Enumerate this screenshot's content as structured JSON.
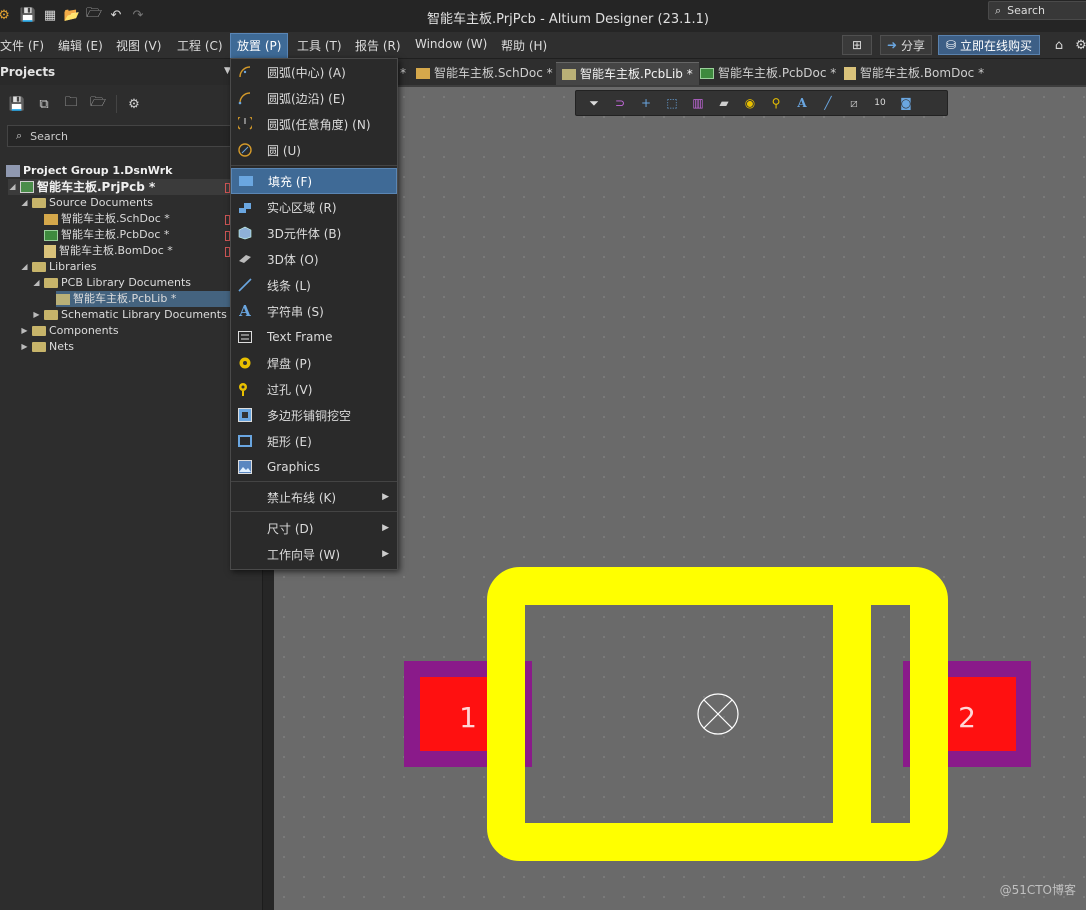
{
  "window": {
    "title": "智能车主板.PrjPcb - Altium Designer (23.1.1)",
    "search_label": "Search"
  },
  "menubar": {
    "items": [
      {
        "label": "文件 (F)"
      },
      {
        "label": "编辑 (E)"
      },
      {
        "label": "视图 (V)"
      },
      {
        "label": "工程 (C)"
      },
      {
        "label": "放置 (P)"
      },
      {
        "label": "工具 (T)"
      },
      {
        "label": "报告 (R)"
      },
      {
        "label": "Window (W)"
      },
      {
        "label": "帮助 (H)"
      }
    ],
    "share_label": "分享",
    "buy_label": "立即在线购买"
  },
  "panel": {
    "title": "Projects",
    "search_placeholder": "Search",
    "tree": [
      {
        "label": "Project Group 1.DsnWrk"
      },
      {
        "label": "智能车主板.PrjPcb *"
      },
      {
        "label": "Source Documents"
      },
      {
        "label": "智能车主板.SchDoc *"
      },
      {
        "label": "智能车主板.PcbDoc *"
      },
      {
        "label": "智能车主板.BomDoc *"
      },
      {
        "label": "Libraries"
      },
      {
        "label": "PCB Library Documents"
      },
      {
        "label": "智能车主板.PcbLib *"
      },
      {
        "label": "Schematic Library Documents"
      },
      {
        "label": "Components"
      },
      {
        "label": "Nets"
      }
    ]
  },
  "tabs": [
    {
      "label": "*"
    },
    {
      "label": "智能车主板.SchDoc *"
    },
    {
      "label": "智能车主板.PcbLib *"
    },
    {
      "label": "智能车主板.PcbDoc *"
    },
    {
      "label": "智能车主板.BomDoc *"
    }
  ],
  "place_menu": {
    "items": [
      {
        "label": "圆弧(中心) (A)",
        "icon": "arc-center-icon"
      },
      {
        "label": "圆弧(边沿) (E)",
        "icon": "arc-edge-icon"
      },
      {
        "label": "圆弧(任意角度) (N)",
        "icon": "arc-any-angle-icon"
      },
      {
        "label": "圆 (U)",
        "icon": "circle-icon"
      },
      {
        "label": "填充 (F)",
        "icon": "fill-icon"
      },
      {
        "label": "实心区域 (R)",
        "icon": "solid-region-icon"
      },
      {
        "label": "3D元件体 (B)",
        "icon": "3d-body-icon"
      },
      {
        "label": "3D体 (O)",
        "icon": "3d-solid-icon"
      },
      {
        "label": "线条 (L)",
        "icon": "line-icon"
      },
      {
        "label": "字符串 (S)",
        "icon": "string-icon"
      },
      {
        "label": "Text Frame",
        "icon": "text-frame-icon"
      },
      {
        "label": "焊盘 (P)",
        "icon": "pad-icon"
      },
      {
        "label": "过孔 (V)",
        "icon": "via-icon"
      },
      {
        "label": "多边形铺铜挖空",
        "icon": "polygon-cutout-icon"
      },
      {
        "label": "矩形 (E)",
        "icon": "rectangle-icon"
      },
      {
        "label": "Graphics",
        "icon": "graphics-icon"
      },
      {
        "label": "禁止布线 (K)"
      },
      {
        "label": "尺寸 (D)"
      },
      {
        "label": "工作向导 (W)"
      }
    ],
    "highlighted": "填充 (F)"
  },
  "footprint": {
    "pad1_label": "1",
    "pad2_label": "2",
    "silkscreen_color": "#ffff00",
    "pad_color": "#ff1010",
    "mask_color": "#8a1a8a"
  },
  "watermark": "@51CTO博客"
}
